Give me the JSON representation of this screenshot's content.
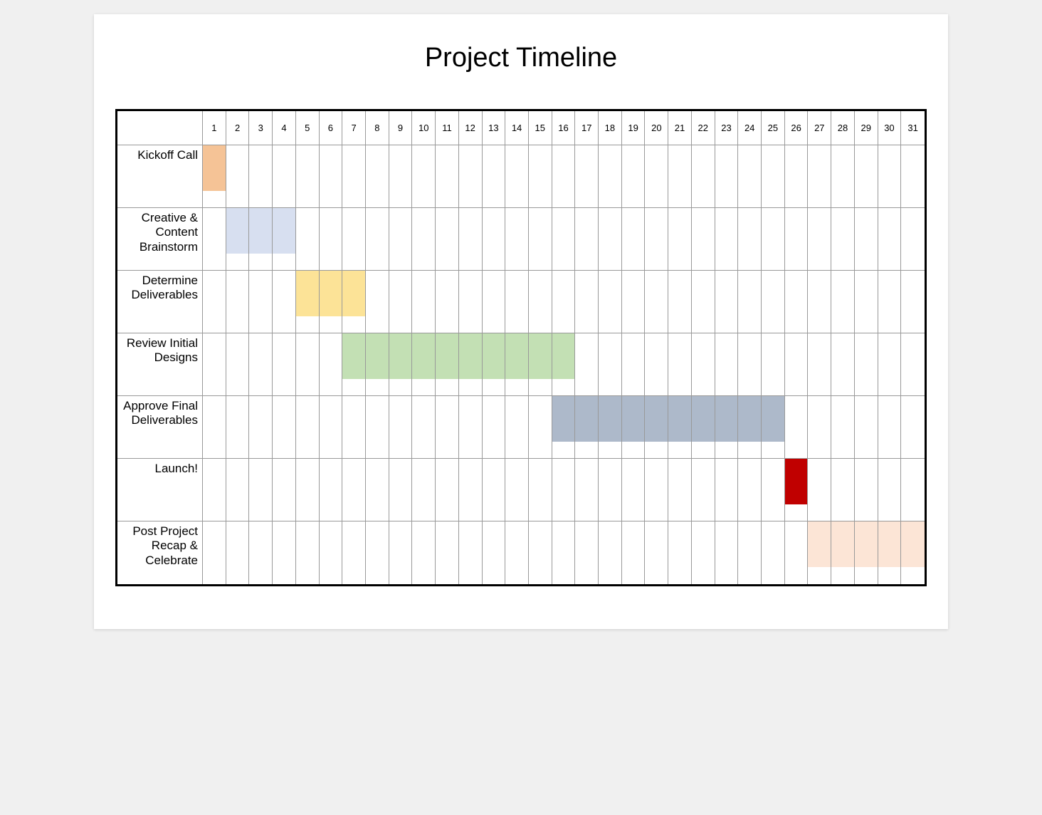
{
  "chart_data": {
    "type": "bar",
    "title": "Project Timeline",
    "xlabel": "",
    "ylabel": "",
    "days": [
      1,
      2,
      3,
      4,
      5,
      6,
      7,
      8,
      9,
      10,
      11,
      12,
      13,
      14,
      15,
      16,
      17,
      18,
      19,
      20,
      21,
      22,
      23,
      24,
      25,
      26,
      27,
      28,
      29,
      30,
      31
    ],
    "tasks": [
      {
        "name": "Kickoff Call",
        "start": 1,
        "end": 1,
        "color": "#f5c396"
      },
      {
        "name": "Creative & Content Brainstorm",
        "start": 2,
        "end": 4,
        "color": "#d7dff0"
      },
      {
        "name": "Determine Deliverables",
        "start": 5,
        "end": 7,
        "color": "#fce397"
      },
      {
        "name": "Review Initial Designs",
        "start": 7,
        "end": 16,
        "color": "#c3e0b4"
      },
      {
        "name": "Approve Final Deliverables",
        "start": 16,
        "end": 25,
        "color": "#adb9ca"
      },
      {
        "name": "Launch!",
        "start": 26,
        "end": 26,
        "color": "#c00000"
      },
      {
        "name": "Post Project Recap & Celebrate",
        "start": 27,
        "end": 31,
        "color": "#fce5d6"
      }
    ]
  }
}
